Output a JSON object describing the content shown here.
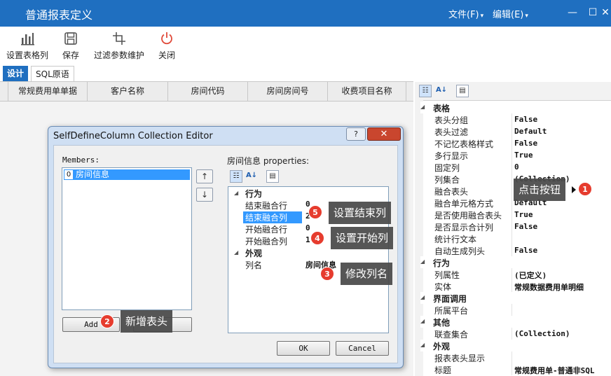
{
  "window": {
    "title": "普通报表定义",
    "menu": [
      {
        "label": "文件(F)"
      },
      {
        "label": "编辑(E)"
      }
    ],
    "controls": {
      "minimize": "—",
      "maximize": "☐",
      "close": "✕"
    }
  },
  "toolbar": {
    "items": [
      {
        "label": "设置表格列",
        "icon": "bar-chart-icon"
      },
      {
        "label": "保存",
        "icon": "save-icon"
      },
      {
        "label": "过滤参数维护",
        "icon": "crop-icon"
      },
      {
        "label": "关闭",
        "icon": "power-icon"
      }
    ]
  },
  "tabs": [
    {
      "label": "设计",
      "active": true
    },
    {
      "label": "SQL原语",
      "active": false
    }
  ],
  "grid": {
    "columns": [
      "常规费用单单据",
      "客户名称",
      "房间代码",
      "房间房间号",
      "收费项目名称"
    ]
  },
  "property_panel": {
    "rows": [
      {
        "type": "category",
        "label": "表格"
      },
      {
        "type": "prop",
        "name": "表头分组",
        "value": "False"
      },
      {
        "type": "prop",
        "name": "表头过滤",
        "value": "Default"
      },
      {
        "type": "prop",
        "name": "不记忆表格样式",
        "value": "False"
      },
      {
        "type": "prop",
        "name": "多行显示",
        "value": "True"
      },
      {
        "type": "prop",
        "name": "固定列",
        "value": "0"
      },
      {
        "type": "prop",
        "name": "列集合",
        "value": "(Collection)"
      },
      {
        "type": "prop",
        "name": "融合表头",
        "value": ""
      },
      {
        "type": "prop",
        "name": "融合单元格方式",
        "value": "Default"
      },
      {
        "type": "prop",
        "name": "是否使用融合表头",
        "value": "True"
      },
      {
        "type": "prop",
        "name": "是否显示合计列",
        "value": "False"
      },
      {
        "type": "prop",
        "name": "统计行文本",
        "value": ""
      },
      {
        "type": "prop",
        "name": "自动生成列头",
        "value": "False"
      },
      {
        "type": "category",
        "label": "行为"
      },
      {
        "type": "prop",
        "name": "列属性",
        "value": "(已定义)"
      },
      {
        "type": "prop",
        "name": "实体",
        "value": "常规数据费用单明细"
      },
      {
        "type": "category",
        "label": "界面调用"
      },
      {
        "type": "prop",
        "name": "所属平台",
        "value": ""
      },
      {
        "type": "category",
        "label": "其他"
      },
      {
        "type": "prop",
        "name": "联查集合",
        "value": "(Collection)"
      },
      {
        "type": "category",
        "label": "外观"
      },
      {
        "type": "prop",
        "name": "报表表头显示",
        "value": ""
      },
      {
        "type": "prop",
        "name": "标题",
        "value": "常规费用单-普通非SQL"
      }
    ]
  },
  "dialog": {
    "title": "SelfDefineColumn Collection Editor",
    "help": "?",
    "close": "✕",
    "members_label": "Members:",
    "members": [
      {
        "index": "0",
        "name": "房间信息"
      }
    ],
    "properties_label": "房间信息 properties:",
    "add_label": "Add",
    "ok_label": "OK",
    "cancel_label": "Cancel",
    "up_arrow": "↑",
    "down_arrow": "↓",
    "properties": [
      {
        "type": "category",
        "label": "行为"
      },
      {
        "type": "prop",
        "name": "结束融合行",
        "value": "0",
        "selected": false
      },
      {
        "type": "prop",
        "name": "结束融合列",
        "value": "2",
        "selected": true
      },
      {
        "type": "prop",
        "name": "开始融合行",
        "value": "0",
        "selected": false
      },
      {
        "type": "prop",
        "name": "开始融合列",
        "value": "1",
        "selected": false
      },
      {
        "type": "category",
        "label": "外观"
      },
      {
        "type": "prop",
        "name": "列名",
        "value": "房间信息",
        "selected": false
      }
    ]
  },
  "annotations": [
    {
      "number": "1",
      "text": "点击按钮"
    },
    {
      "number": "2",
      "text": "新增表头"
    },
    {
      "number": "3",
      "text": "修改列名"
    },
    {
      "number": "4",
      "text": "设置开始列"
    },
    {
      "number": "5",
      "text": "设置结束列"
    }
  ]
}
